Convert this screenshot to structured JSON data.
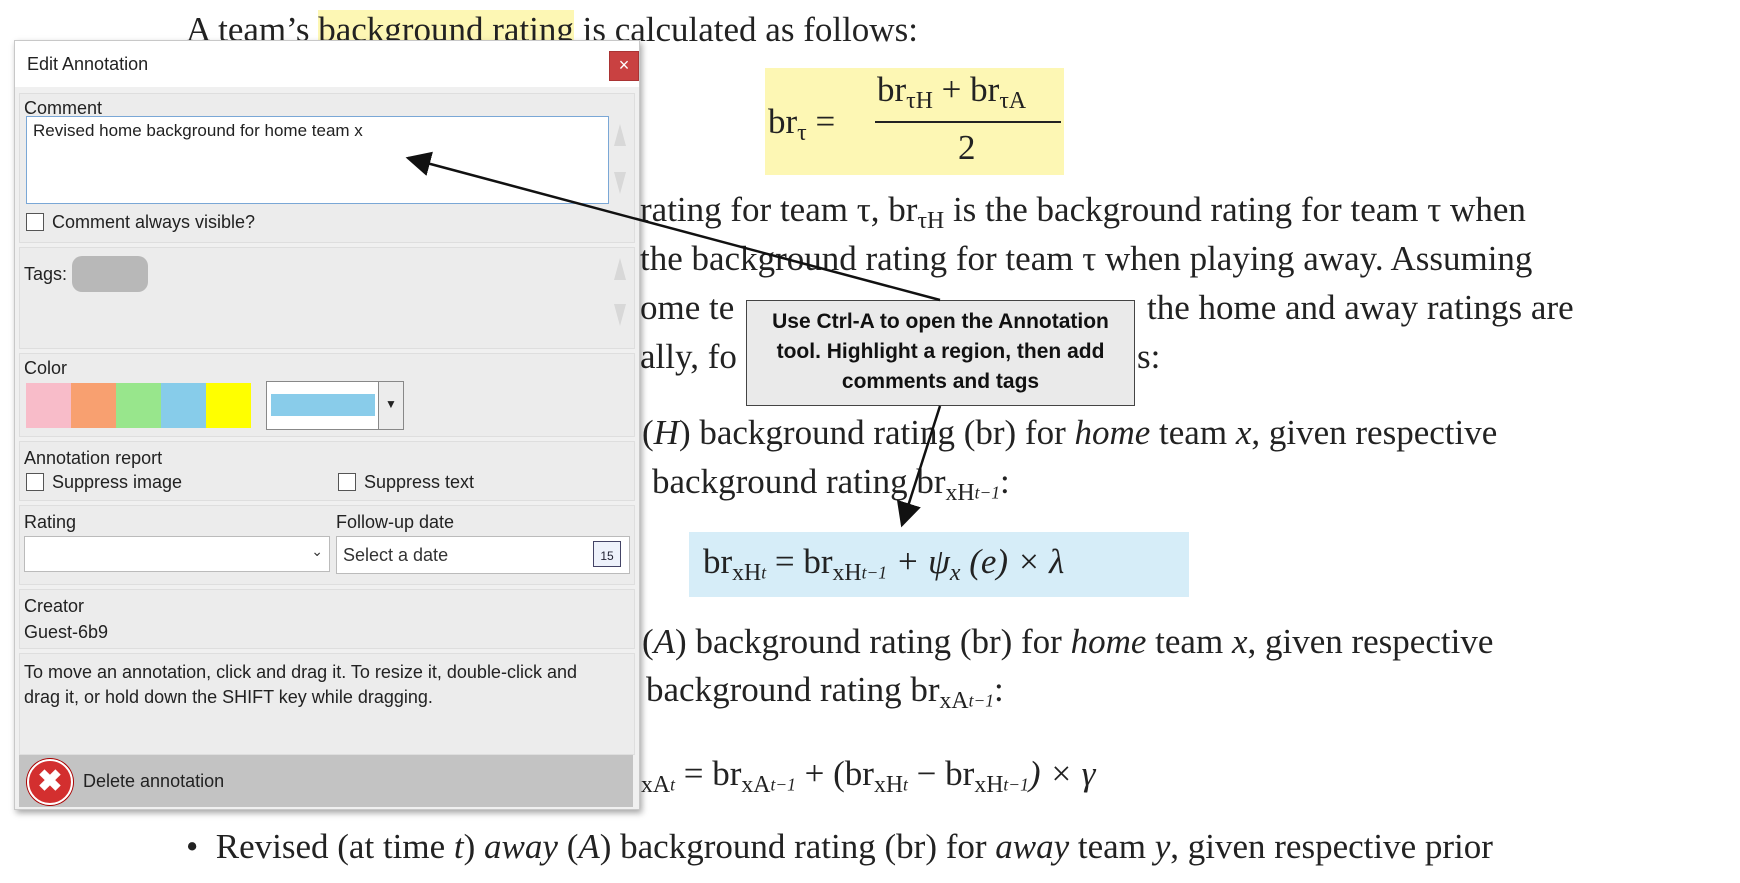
{
  "document": {
    "line_intro_pre": "A team’s ",
    "line_intro_hl": "background rating",
    "line_intro_post": " is calculated as follows:",
    "eq1": {
      "lhs": "br",
      "lhs_sub": "τ",
      "eq": "=",
      "num_a": "br",
      "num_a_sub": "τH",
      "plus": "+",
      "num_b": "br",
      "num_b_sub": "τA",
      "den": "2"
    },
    "line_where1": "rating for team τ, br",
    "line_where1_sub": "τH",
    "line_where1_post": " is the background rating for team τ when",
    "line_where2": "the background rating for team τ when playing away. Assuming",
    "line_where3_a": "ome te",
    "line_where3_b": "the home and away ratings are",
    "line_where4": "ally, fo",
    "line_where4_end": "s:",
    "bullet1_a": "(",
    "bullet1_H": "H",
    "bullet1_b": ") background rating (br) for ",
    "bullet1_home": "home",
    "bullet1_c": " team ",
    "bullet1_x": "x",
    "bullet1_d": ", given respective",
    "bullet1_line2": "background rating br",
    "bullet1_line2_sub": "xH",
    "bullet1_line2_sub2": "t−1",
    "bullet1_line2_end": ":",
    "eq2": "br",
    "eq2_sub": "xH",
    "eq2_subt": "t",
    "eq2_rest_a": " = br",
    "eq2_rest_sub": "xH",
    "eq2_rest_sub2": "t−1",
    "eq2_rest_b": " + ψ",
    "eq2_psi_sub": "x",
    "eq2_rest_c": " (e) × λ",
    "bullet2_a": "(",
    "bullet2_A": "A",
    "bullet2_b": ") background rating (br) for ",
    "bullet2_home": "home",
    "bullet2_c": " team ",
    "bullet2_x": "x",
    "bullet2_d": ", given respective",
    "bullet2_line2": "background rating br",
    "bullet2_line2_sub": "xA",
    "bullet2_line2_sub2": "t−1",
    "bullet2_line2_end": ":",
    "eq3": "xA",
    "eq3_subt": "t",
    "eq3_rest": " = br",
    "eq3_sub": "xA",
    "eq3_sub2": "t−1",
    "eq3_rest2": " + (br",
    "eq3_sub3": "xH",
    "eq3_sub3t": "t",
    "eq3_rest3": " − br",
    "eq3_sub4": "xH",
    "eq3_sub4t": "t−1",
    "eq3_rest4": ") × γ",
    "bullet3_bullet": "•",
    "bullet3_a": "Revised (at time ",
    "bullet3_t": "t",
    "bullet3_b": ") ",
    "bullet3_away": "away",
    "bullet3_c": " (",
    "bullet3_A": "A",
    "bullet3_d": ") background rating (br) for ",
    "bullet3_away2": "away",
    "bullet3_e": " team ",
    "bullet3_y": "y",
    "bullet3_f": ", given respective prior"
  },
  "dialog": {
    "title": "Edit Annotation",
    "close": "×",
    "comment_label": "Comment",
    "comment_value": "Revised home background for home team x",
    "always_visible": "Comment always visible?",
    "tags_label": "Tags:",
    "color_label": "Color",
    "swatches": [
      "#f8bcc9",
      "#f8a070",
      "#98e68c",
      "#87ccea",
      "#ffff00"
    ],
    "selected_color": "#89ccea",
    "report_label": "Annotation report",
    "suppress_image": "Suppress image",
    "suppress_text": "Suppress text",
    "rating_label": "Rating",
    "rating_value": "",
    "followup_label": "Follow-up date",
    "followup_placeholder": "Select a date",
    "calendar_day": "15",
    "creator_label": "Creator",
    "creator_value": "Guest-6b9",
    "help_line1": "To move an annotation, click and drag it. To resize it, double-click and",
    "help_line2": "drag it, or hold down the SHIFT key while dragging.",
    "delete_label": "Delete annotation"
  },
  "callout": {
    "line1": "Use Ctrl-A to open the Annotation",
    "line2": "tool. Highlight a region, then add",
    "line3": "comments and tags"
  }
}
